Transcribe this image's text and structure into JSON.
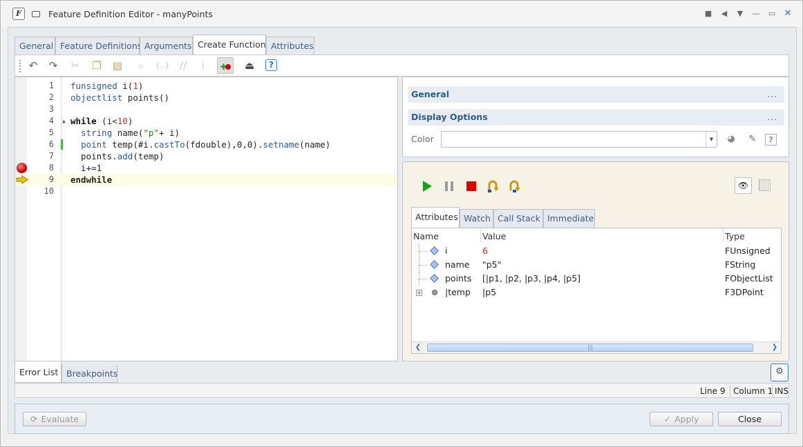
{
  "window": {
    "title": "Feature Definition Editor - manyPoints",
    "app_letter": "F"
  },
  "tabs": [
    {
      "label": "General"
    },
    {
      "label": "Feature Definitions"
    },
    {
      "label": "Arguments"
    },
    {
      "label": "Create Function"
    },
    {
      "label": "Attributes"
    }
  ],
  "toolbar": {
    "help_label": "?"
  },
  "editor": {
    "lines": [
      {
        "num": "1",
        "text": "funsigned i(1)"
      },
      {
        "num": "2",
        "text": "objectlist points()"
      },
      {
        "num": "3",
        "text": ""
      },
      {
        "num": "4",
        "text": "while (i<10)"
      },
      {
        "num": "5",
        "text": "  string name(\"p\"+ i)"
      },
      {
        "num": "6",
        "text": "  point temp(#i.castTo(fdouble),0,0).setname(name)"
      },
      {
        "num": "7",
        "text": "  points.add(temp)"
      },
      {
        "num": "8",
        "text": "  i+=1"
      },
      {
        "num": "9",
        "text": "endwhile"
      },
      {
        "num": "10",
        "text": ""
      }
    ]
  },
  "properties": {
    "sections": [
      {
        "label": "General",
        "dots": "..."
      },
      {
        "label": "Display Options",
        "dots": "..."
      }
    ],
    "color_label": "Color",
    "color_value": ""
  },
  "debugger": {
    "tabs": [
      {
        "label": "Attributes"
      },
      {
        "label": "Watch"
      },
      {
        "label": "Call Stack"
      },
      {
        "label": "Immediate"
      }
    ],
    "columns": {
      "name": "Name",
      "value": "Value",
      "type": "Type"
    },
    "rows": [
      {
        "name": "i",
        "value": "6",
        "type": "FUnsigned"
      },
      {
        "name": "name",
        "value": "\"p5\"",
        "type": "FString"
      },
      {
        "name": "points",
        "value": "[|p1, |p2, |p3, |p4, |p5]",
        "type": "FObjectList"
      },
      {
        "name": "|temp",
        "value": "|p5",
        "type": "F3DPoint"
      }
    ]
  },
  "bottom_tabs": [
    {
      "label": "Error List"
    },
    {
      "label": "Breakpoints"
    }
  ],
  "status": {
    "line": "Line 9",
    "column": "Column 1",
    "mode": "INS"
  },
  "footer": {
    "evaluate_label": "Evaluate",
    "apply_label": "Apply",
    "close_label": "Close"
  }
}
